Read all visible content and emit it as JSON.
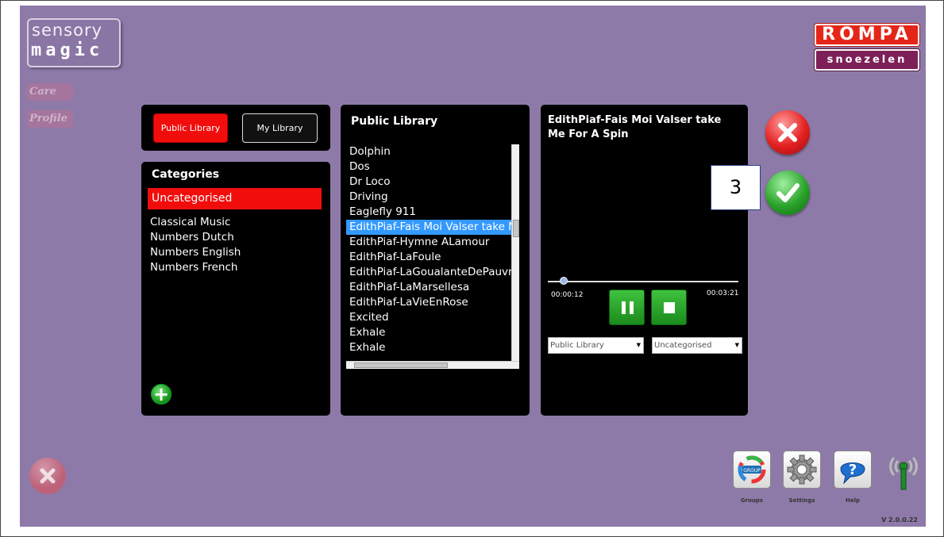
{
  "app": {
    "logo_line1": "sensory",
    "logo_line2": "magic",
    "care_logo": "Care",
    "profile_logo": "Profile",
    "brand_top": "ROMPA",
    "brand_bottom": "snoezelen",
    "version": "V 2.0.0.22",
    "accent_red": "#f20d0d",
    "accent_green": "#2aa22a",
    "background": "#8e7aa8"
  },
  "library_tabs": {
    "public": "Public Library",
    "my": "My Library",
    "active": "Public Library"
  },
  "categories": {
    "title": "Categories",
    "selected": "Uncategorised",
    "items": [
      "Classical Music",
      "Numbers Dutch",
      "Numbers English",
      "Numbers French"
    ]
  },
  "tracks": {
    "title": "Public Library",
    "items": [
      "Dolphin",
      "Dos",
      "Dr Loco",
      "Driving",
      "Eaglefly 911",
      "EdithPiaf-Fais Moi Valser take Me",
      "EdithPiaf-Hymne ALamour",
      "EdithPiaf-LaFoule",
      "EdithPiaf-LaGoualanteDePauvreJ",
      "EdithPiaf-LaMarsellesa",
      "EdithPiaf-LaVieEnRose",
      "Excited",
      "Exhale",
      "Exhale"
    ],
    "selected_index": 5
  },
  "player": {
    "title": "EdithPiaf-Fais Moi Valser take Me For A Spin",
    "current_time": "00:00:12",
    "total_time": "00:03:21",
    "library_select": "Public Library",
    "category_select": "Uncategorised"
  },
  "callout": "3",
  "bottom_bar": {
    "groups": "Groups",
    "groups_icon_text": "GROUP",
    "settings": "Settings",
    "help": "Help"
  }
}
